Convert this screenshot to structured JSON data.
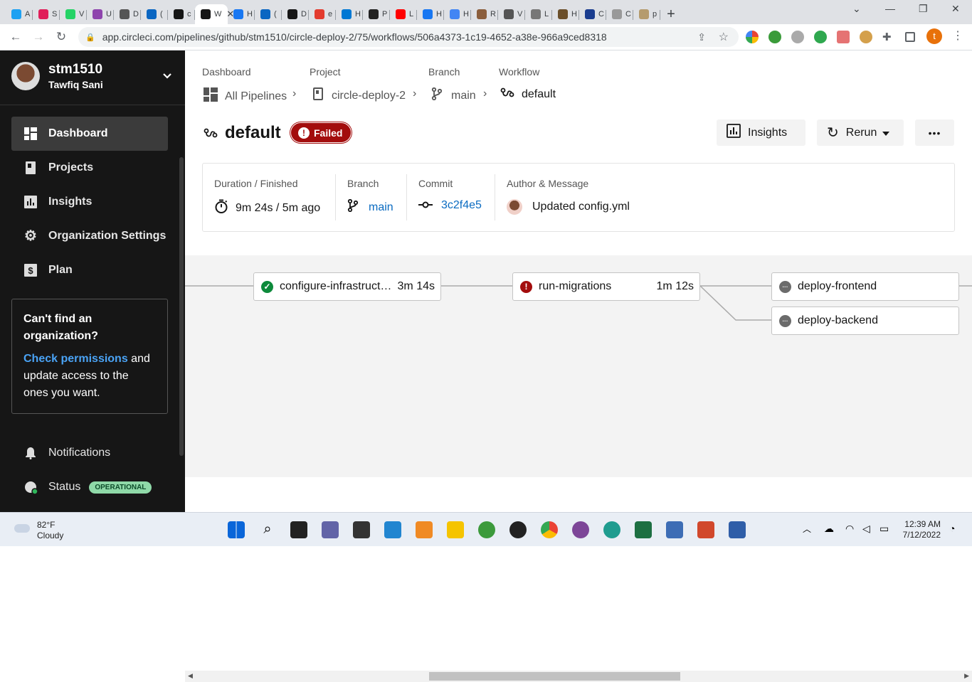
{
  "browser": {
    "tabs": [
      {
        "label": "A",
        "color": "#1da1f2"
      },
      {
        "label": "S",
        "color": "#e01e5a"
      },
      {
        "label": "V",
        "color": "#25d366"
      },
      {
        "label": "U",
        "color": "#8e44ad"
      },
      {
        "label": "D",
        "color": "#555555"
      },
      {
        "label": "(",
        "color": "#0a66c2"
      },
      {
        "label": "c",
        "color": "#161616"
      },
      {
        "label": "W",
        "color": "#161616",
        "active": true
      },
      {
        "label": "H",
        "color": "#1877f2"
      },
      {
        "label": "(",
        "color": "#0a66c2"
      },
      {
        "label": "D",
        "color": "#161616"
      },
      {
        "label": "e",
        "color": "#e33b2e"
      },
      {
        "label": "H",
        "color": "#0078d4"
      },
      {
        "label": "P",
        "color": "#222222"
      },
      {
        "label": "L",
        "color": "#ff0000"
      },
      {
        "label": "H",
        "color": "#1877f2"
      },
      {
        "label": "H",
        "color": "#4285f4"
      },
      {
        "label": "R",
        "color": "#8b5e3c"
      },
      {
        "label": "V",
        "color": "#555555"
      },
      {
        "label": "L",
        "color": "#777777"
      },
      {
        "label": "H",
        "color": "#6b4f2a"
      },
      {
        "label": "C",
        "color": "#1a3d8f"
      },
      {
        "label": "C",
        "color": "#999999"
      },
      {
        "label": "p",
        "color": "#b59b6d"
      }
    ],
    "new_tab_label": "+",
    "url": "app.circleci.com/pipelines/github/stm1510/circle-deploy-2/75/workflows/506a4373-1c19-4652-a38e-966a9ced8318",
    "profile_letter": "t"
  },
  "sidebar": {
    "username": "stm1510",
    "fullname": "Tawfiq Sani",
    "items": [
      {
        "label": "Dashboard",
        "icon": "dashboard-icon"
      },
      {
        "label": "Projects",
        "icon": "projects-icon"
      },
      {
        "label": "Insights",
        "icon": "insights-icon"
      },
      {
        "label": "Organization Settings",
        "icon": "gear-icon"
      },
      {
        "label": "Plan",
        "icon": "dollar-icon"
      }
    ],
    "card": {
      "title": "Can't find an organization?",
      "link": "Check permissions",
      "text1": " and",
      "text2": "update access to the",
      "text3": "ones you want."
    },
    "notifications": "Notifications",
    "status": "Status",
    "status_badge": "OPERATIONAL"
  },
  "breadcrumb": {
    "labels": [
      "Dashboard",
      "Project",
      "Branch",
      "Workflow"
    ],
    "values": [
      "All Pipelines",
      "circle-deploy-2",
      "main",
      "default"
    ]
  },
  "workflow": {
    "title": "default",
    "status": "Failed",
    "insights_label": "Insights",
    "rerun_label": "Rerun",
    "more_label": "•••"
  },
  "info": {
    "duration_label": "Duration / Finished",
    "duration_value": "9m 24s / 5m ago",
    "branch_label": "Branch",
    "branch_value": "main",
    "commit_label": "Commit",
    "commit_value": "3c2f4e5",
    "author_label": "Author & Message",
    "author_message": "Updated config.yml"
  },
  "jobs": [
    {
      "name": "configure-infrastructure",
      "duration": "3m 14s",
      "status": "success"
    },
    {
      "name": "run-migrations",
      "duration": "1m 12s",
      "status": "failed"
    },
    {
      "name": "deploy-frontend",
      "duration": "",
      "status": "not-run"
    },
    {
      "name": "deploy-backend",
      "duration": "",
      "status": "not-run"
    }
  ],
  "status_colors": {
    "success": "#0d8a3b",
    "failed": "#a30d0d",
    "not-run": "#6b6b6b"
  },
  "taskbar": {
    "weather_temp": "82°F",
    "weather_desc": "Cloudy",
    "time": "12:39 AM",
    "date": "7/12/2022"
  }
}
